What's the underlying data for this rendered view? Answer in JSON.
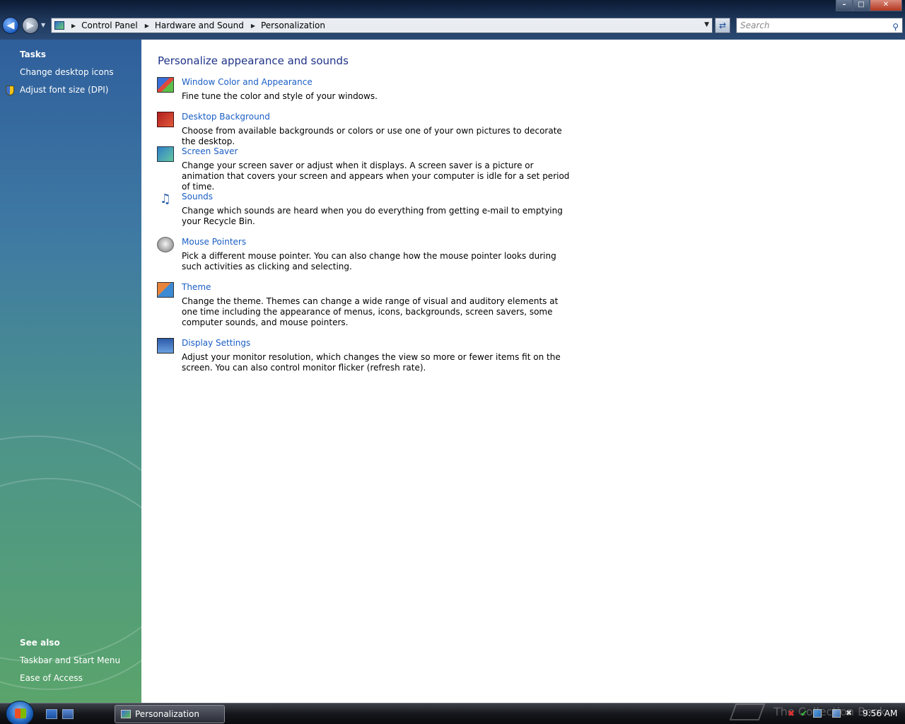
{
  "window": {
    "minimize": "–",
    "maximize": "□",
    "close": "✕"
  },
  "navigation": {
    "back": "◀",
    "forward": "▶",
    "dropdown": "▼"
  },
  "address": {
    "crumbs": [
      "Control Panel",
      "Hardware and Sound",
      "Personalization"
    ],
    "separator": "▶",
    "dropdown": "▼",
    "refresh": "⇄"
  },
  "search": {
    "placeholder": "Search",
    "icon": "⚲"
  },
  "left_pane": {
    "tasks_heading": "Tasks",
    "tasks": [
      "Change desktop icons",
      "Adjust font size (DPI)"
    ],
    "see_also_heading": "See also",
    "see_also": [
      "Taskbar and Start Menu",
      "Ease of Access"
    ]
  },
  "main": {
    "title": "Personalize appearance and sounds",
    "items": [
      {
        "title": "Window Color and Appearance",
        "desc": "Fine tune the color and style of your windows.",
        "icon": "window-color-icon"
      },
      {
        "title": "Desktop Background",
        "desc": "Choose from available backgrounds or colors or use one of your own pictures to decorate the desktop.",
        "icon": "desktop-background-icon"
      },
      {
        "title": "Screen Saver",
        "desc": "Change your screen saver or adjust when it displays. A screen saver is a picture or animation that covers your screen and appears when your computer is idle for a set period of time.",
        "icon": "screen-saver-icon"
      },
      {
        "title": "Sounds",
        "desc": "Change which sounds are heard when you do everything from getting e-mail to emptying your Recycle Bin.",
        "icon": "sounds-icon"
      },
      {
        "title": "Mouse Pointers",
        "desc": "Pick a different mouse pointer. You can also change how the mouse pointer looks during such activities as clicking and selecting.",
        "icon": "mouse-pointers-icon"
      },
      {
        "title": "Theme",
        "desc": "Change the theme. Themes can change a wide range of visual and auditory elements at one time including the appearance of menus, icons, backgrounds, screen savers, some computer sounds, and mouse pointers.",
        "icon": "theme-icon"
      },
      {
        "title": "Display Settings",
        "desc": "Adjust your monitor resolution, which changes the view so more or fewer items fit on the screen. You can also control monitor flicker (refresh rate).",
        "icon": "display-settings-icon"
      }
    ]
  },
  "taskbar": {
    "task_label": "Personalization",
    "watermark": "The Collection Book",
    "clock": "9:56 AM",
    "tray_error": "✖",
    "tray_ok": "✔",
    "tray_volume": "✖"
  },
  "colors": {
    "link": "#1a5ec4",
    "title": "#1e3287"
  }
}
